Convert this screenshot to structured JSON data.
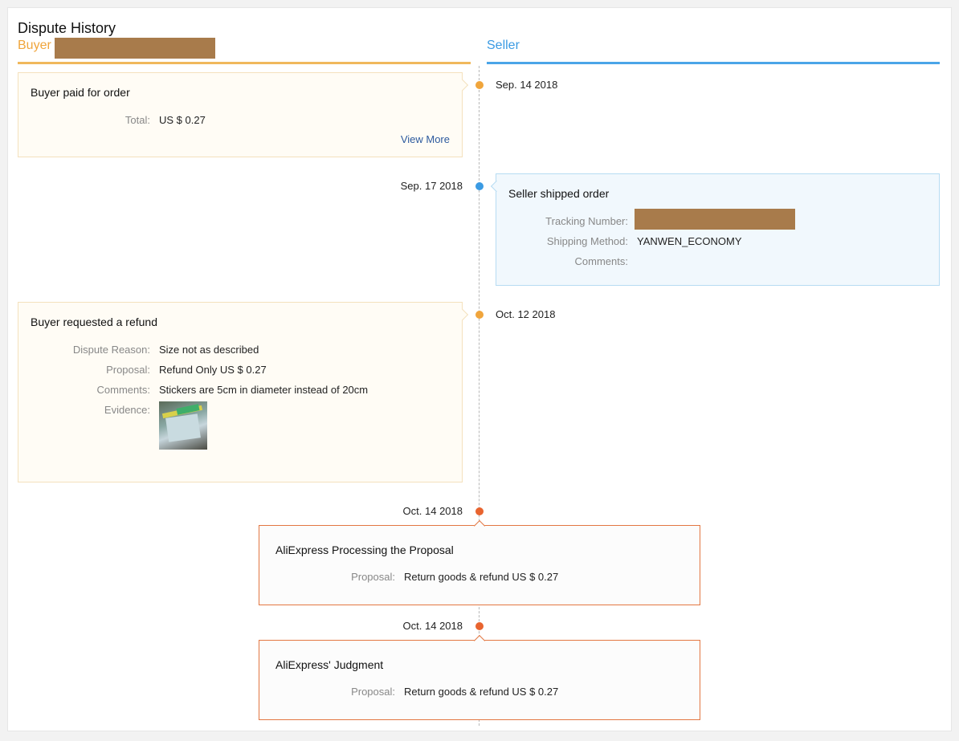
{
  "page": {
    "title": "Dispute History"
  },
  "columns": {
    "buyer": "Buyer",
    "seller": "Seller"
  },
  "colors": {
    "buyer": "#f0a53c",
    "seller": "#3b9be3",
    "aliexpress": "#e8642f",
    "link": "#2d5a9e",
    "redaction": "#a87b4b"
  },
  "events": {
    "paid": {
      "date": "Sep. 14 2018",
      "title": "Buyer paid for order",
      "total_label": "Total:",
      "total_value": "US $ 0.27",
      "view_more": "View More"
    },
    "shipped": {
      "date": "Sep. 17 2018",
      "title": "Seller shipped order",
      "tracking_label": "Tracking Number:",
      "method_label": "Shipping Method:",
      "method_value": "YANWEN_ECONOMY",
      "comments_label": "Comments:"
    },
    "refund": {
      "date": "Oct. 12 2018",
      "title": "Buyer requested a refund",
      "reason_label": "Dispute Reason:",
      "reason_value": "Size not as described",
      "proposal_label": "Proposal:",
      "proposal_value": "Refund Only US $ 0.27",
      "comments_label": "Comments:",
      "comments_value": "Stickers are 5cm in diameter instead of 20cm",
      "evidence_label": "Evidence:"
    },
    "processing": {
      "date": "Oct. 14 2018",
      "title": "AliExpress Processing the Proposal",
      "proposal_label": "Proposal:",
      "proposal_value": "Return goods & refund US $ 0.27"
    },
    "judgment": {
      "date": "Oct. 14 2018",
      "title": "AliExpress' Judgment",
      "proposal_label": "Proposal:",
      "proposal_value": "Return goods & refund US $ 0.27"
    }
  }
}
